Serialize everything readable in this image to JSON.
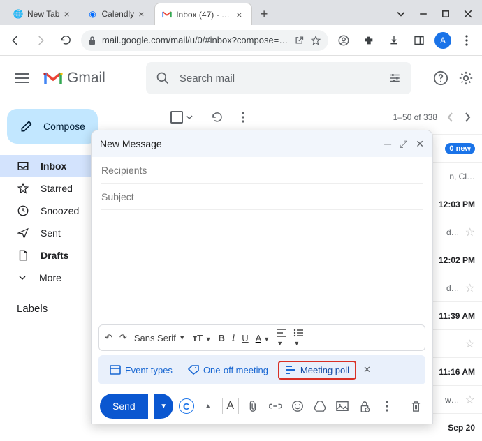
{
  "browser": {
    "tabs": [
      {
        "title": "New Tab",
        "favicon": "globe"
      },
      {
        "title": "Calendly",
        "favicon": "calendly"
      },
      {
        "title": "Inbox (47) - a…",
        "favicon": "gmail"
      }
    ],
    "url_display": "mail.google.com/mail/u/0/#inbox?compose=…",
    "profile_letter": "A"
  },
  "gmail": {
    "brand": "Gmail",
    "search_placeholder": "Search mail",
    "compose_label": "Compose",
    "nav": {
      "inbox": "Inbox",
      "starred": "Starred",
      "snoozed": "Snoozed",
      "sent": "Sent",
      "drafts": "Drafts",
      "more": "More"
    },
    "labels_heading": "Labels",
    "pager": "1–50 of 338",
    "rows": [
      {
        "text": "0 new",
        "suffix": "n, Cl…"
      },
      {
        "time": "12:03 PM"
      },
      {
        "suffix": "d…"
      },
      {
        "time": "12:02 PM"
      },
      {
        "suffix": "d…"
      },
      {
        "time": "11:39 AM"
      },
      {
        "time": "11:16 AM"
      },
      {
        "suffix": "w…"
      },
      {
        "time": "Sep 20"
      }
    ]
  },
  "compose": {
    "title": "New Message",
    "recipients_ph": "Recipients",
    "subject_ph": "Subject",
    "font": "Sans Serif",
    "ext": {
      "event_types": "Event types",
      "one_off": "One-off meeting",
      "meeting_poll": "Meeting poll"
    },
    "send": "Send"
  }
}
